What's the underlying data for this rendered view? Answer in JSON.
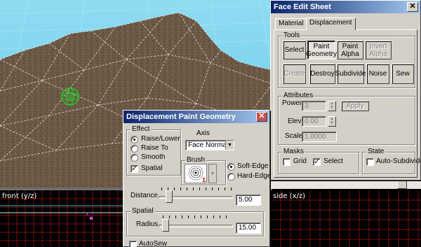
{
  "viewports": {
    "front_label": "front (y/z)",
    "side_label": "side (x/z)"
  },
  "face_edit_sheet": {
    "title": "Face Edit Sheet",
    "tabs": [
      {
        "label": "Material",
        "active": false
      },
      {
        "label": "Displacement",
        "active": true
      }
    ],
    "tools_label": "Tools",
    "tool_buttons_row1": [
      {
        "label": "Select",
        "state": "normal"
      },
      {
        "label": "Paint Geometry",
        "state": "pressed"
      },
      {
        "label": "Paint Alpha",
        "state": "normal"
      },
      {
        "label": "Invert Alpha",
        "state": "disabled"
      }
    ],
    "tool_buttons_row2": [
      {
        "label": "Create",
        "state": "disabled"
      },
      {
        "label": "Destroy",
        "state": "normal"
      },
      {
        "label": "Subdivide",
        "state": "normal"
      },
      {
        "label": "Noise",
        "state": "normal"
      },
      {
        "label": "Sew",
        "state": "normal"
      }
    ],
    "attributes_label": "Attributes",
    "power_label": "Power",
    "power_value": "3",
    "apply_label": "Apply",
    "elev_label": "Elev",
    "elev_value": "0.00",
    "scale_label": "Scale",
    "scale_value": "1.0000",
    "masks_label": "Masks",
    "grid_label": "Grid",
    "grid_checked": false,
    "select_label": "Select",
    "select_checked": true,
    "state_label": "State",
    "autosubdivide_label": "Auto-Subdivide",
    "autosubdivide_checked": false
  },
  "paint_dialog": {
    "title": "Displacement Paint Geometry",
    "effect_label": "Effect",
    "effect_options": [
      "Raise/Lower",
      "Raise To",
      "Smooth"
    ],
    "effect_selected": "Raise/Lower",
    "spatial_check_label": "Spatial",
    "spatial_checked": true,
    "axis_label": "Axis",
    "axis_value": "Face Normal",
    "brush_label": "Brush",
    "brush_number": "1",
    "edge_options": [
      "Soft-Edge",
      "Hard-Edge"
    ],
    "edge_selected": "Soft-Edge",
    "distance_label": "Distance",
    "distance_value": "5.00",
    "distance_fraction": 0.1,
    "spatial_group_label": "Spatial",
    "radius_label": "Radius",
    "radius_value": "15.00",
    "radius_fraction": 0.05,
    "autosew_label": "AutoSew",
    "autosew_checked": false
  },
  "colors": {
    "sky": "#7fd6f0",
    "terrain": "#7a6650",
    "titlebar_start": "#0a246a",
    "titlebar_end": "#a6caf0",
    "grid_red": "#b02020"
  }
}
